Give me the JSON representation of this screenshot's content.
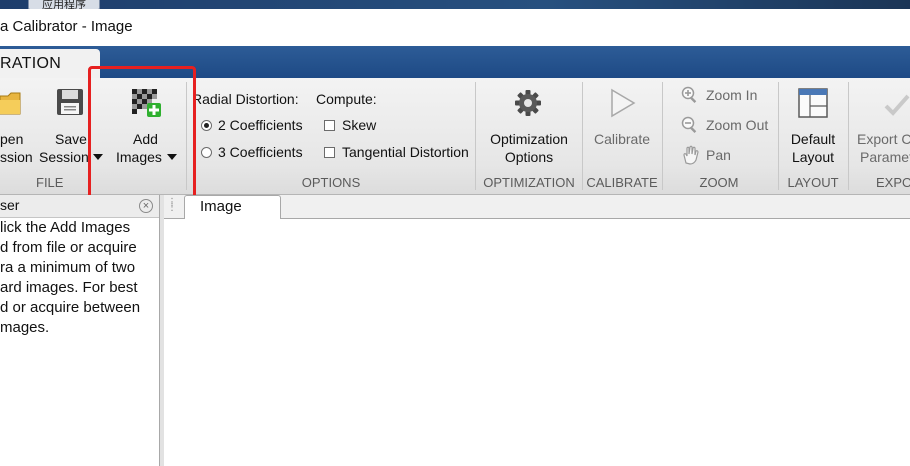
{
  "taskbar": {
    "tab_label": "应用程序"
  },
  "window": {
    "title": "a Calibrator - Image"
  },
  "ribbon": {
    "tab": "RATION",
    "file": {
      "open_label": [
        "pen",
        "ssion"
      ],
      "save_label": [
        "Save",
        "Session"
      ],
      "add_label": [
        "Add",
        "Images"
      ],
      "group": "FILE"
    },
    "options": {
      "radial_label": "Radial Distortion:",
      "compute_label": "Compute:",
      "coeff2": "2 Coefficients",
      "coeff3": "3 Coefficients",
      "selected_coefficients": "2 Coefficients",
      "skew": "Skew",
      "tangential": "Tangential Distortion",
      "group": "OPTIONS"
    },
    "optimization": {
      "label": [
        "Optimization",
        "Options"
      ],
      "group": "OPTIMIZATION"
    },
    "calibrate": {
      "label": "Calibrate",
      "group": "CALIBRATE"
    },
    "zoom": {
      "zoom_in": "Zoom In",
      "zoom_out": "Zoom Out",
      "pan": "Pan",
      "group": "ZOOM"
    },
    "layout": {
      "label": [
        "Default",
        "Layout"
      ],
      "group": "LAYOUT"
    },
    "export": {
      "label": [
        "Export C",
        "Paramet"
      ],
      "group": "EXPO"
    }
  },
  "browser": {
    "title": "ser",
    "close": "×",
    "help_lines": [
      "lick the Add Images",
      "d from file or acquire",
      "ra a minimum of two",
      "ard images. For best",
      "d or acquire between",
      "mages."
    ]
  },
  "main": {
    "tab": "Image"
  },
  "colors": {
    "highlight": "#e62020",
    "band": "#1e4a85"
  }
}
